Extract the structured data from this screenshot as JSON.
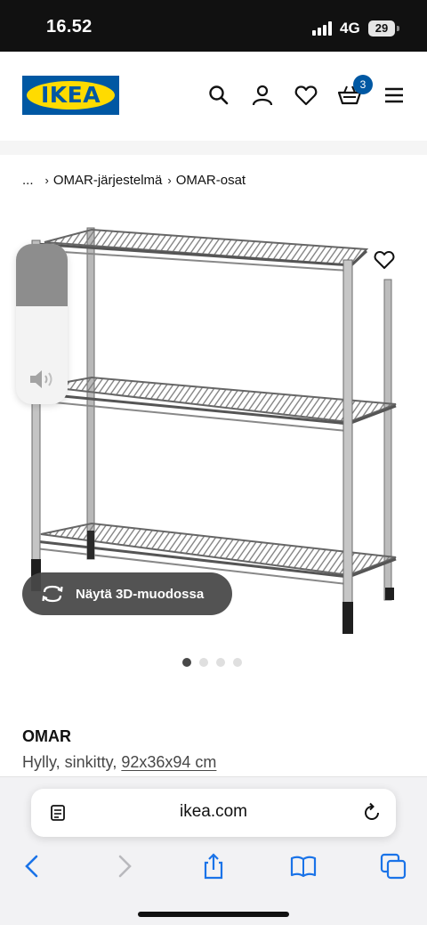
{
  "status_bar": {
    "time": "16.52",
    "network": "4G",
    "battery": "29"
  },
  "header": {
    "logo": "IKEA",
    "cart_count": "3",
    "accent_color": "#0058a3",
    "logo_yellow": "#ffdb00"
  },
  "breadcrumb": {
    "ellipsis": "...",
    "items": [
      "OMAR-järjestelmä",
      "OMAR-osat"
    ]
  },
  "gallery": {
    "view_3d_label": "Näytä 3D-muodossa",
    "image_count": 4,
    "active_image": 1
  },
  "product": {
    "name": "OMAR",
    "description": "Hylly, sinkitty,",
    "size": "92x36x94 cm"
  },
  "browser": {
    "url": "ikea.com"
  }
}
